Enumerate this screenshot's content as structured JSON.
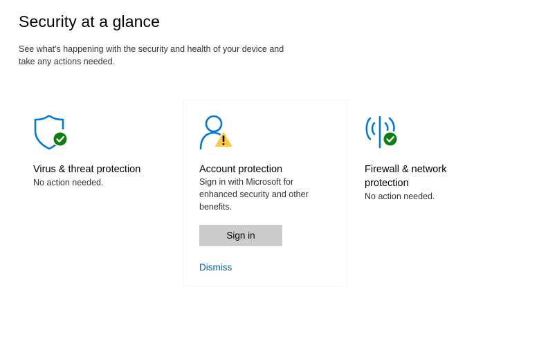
{
  "header": {
    "title": "Security at a glance",
    "subtitle": "See what's happening with the security and health of your device and take any actions needed."
  },
  "cards": [
    {
      "icon": "shield-check-icon",
      "status_icon": "checkmark-badge-icon",
      "title": "Virus & threat protection",
      "description": "No action needed."
    },
    {
      "icon": "person-icon",
      "status_icon": "warning-badge-icon",
      "title": "Account protection",
      "description": "Sign in with Microsoft for enhanced security and other benefits.",
      "primary_action": "Sign in",
      "secondary_action": "Dismiss"
    },
    {
      "icon": "wireless-antenna-icon",
      "status_icon": "checkmark-badge-icon",
      "title": "Firewall & network protection",
      "description": "No action needed."
    }
  ],
  "colors": {
    "icon_blue": "#0078d7",
    "ok_green": "#107c10",
    "warning_yellow": "#ffc83d",
    "link_blue": "#0063b1",
    "button_gray": "#cccccc"
  }
}
